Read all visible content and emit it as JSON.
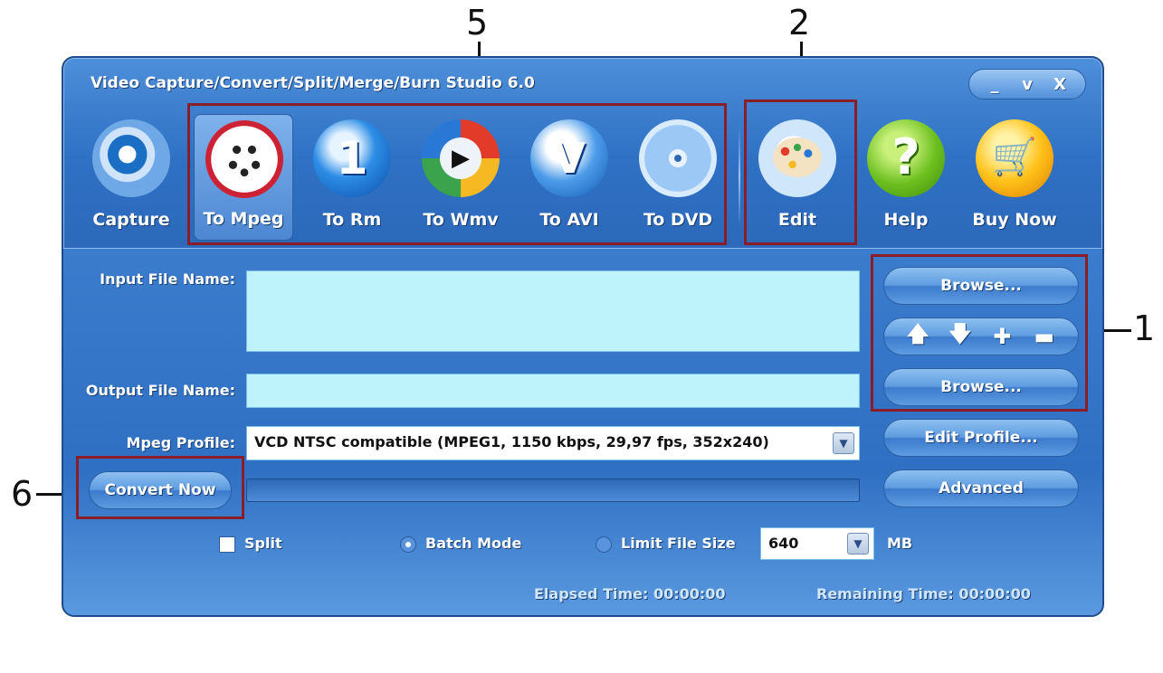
{
  "window": {
    "title": "Video Capture/Convert/Split/Merge/Burn Studio 6.0",
    "controls": [
      "_",
      "v",
      "X"
    ]
  },
  "toolbar": {
    "tools": [
      {
        "label": "Capture",
        "icon": "camcorder-icon"
      },
      {
        "label": "To Mpeg",
        "icon": "film-reel-icon",
        "selected": true
      },
      {
        "label": "To Rm",
        "icon": "real-media-icon"
      },
      {
        "label": "To Wmv",
        "icon": "windows-media-icon"
      },
      {
        "label": "To AVI",
        "icon": "avi-icon"
      },
      {
        "label": "To DVD",
        "icon": "dvd-disc-icon"
      },
      {
        "label": "Edit",
        "icon": "paint-palette-icon"
      },
      {
        "label": "Help",
        "icon": "help-icon"
      },
      {
        "label": "Buy Now",
        "icon": "shopping-cart-icon"
      }
    ]
  },
  "form": {
    "input_label": "Input File Name:",
    "output_label": "Output File Name:",
    "profile_label": "Mpeg Profile:",
    "profile_value": "VCD NTSC compatible (MPEG1, 1150 kbps, 29,97 fps, 352x240)",
    "browse_input": "Browse...",
    "browse_output": "Browse...",
    "edit_profile": "Edit Profile...",
    "advanced": "Advanced",
    "convert_now": "Convert Now",
    "list_controls": [
      "🡅",
      "🡇",
      "✚",
      "▬"
    ]
  },
  "options": {
    "split": "Split",
    "batch_mode": "Batch Mode",
    "limit_file_size": "Limit File Size",
    "size_value": "640",
    "size_unit": "MB"
  },
  "status": {
    "elapsed": "Elapsed Time: 00:00:00",
    "remaining": "Remaining Time: 00:00:00"
  },
  "annotations": {
    "n1": "1",
    "n2": "2",
    "n5": "5",
    "n6": "6"
  }
}
